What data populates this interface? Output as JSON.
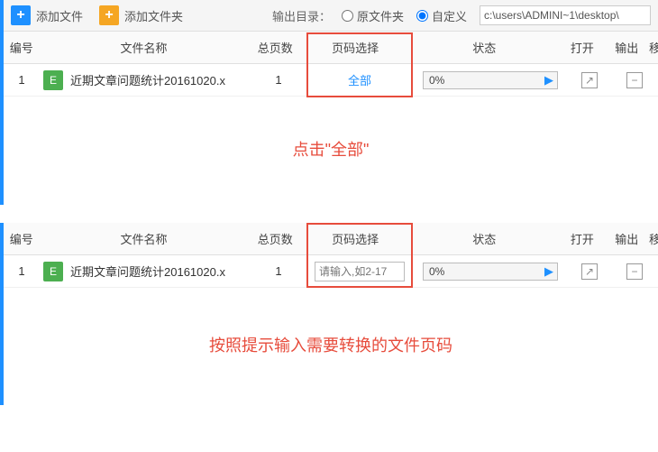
{
  "toolbar": {
    "add_file": "添加文件",
    "add_folder": "添加文件夹",
    "output_dir_label": "输出目录：",
    "original_folder": "原文件夹",
    "custom": "自定义",
    "path": "c:\\users\\ADMINI~1\\desktop\\"
  },
  "headers": {
    "num": "编号",
    "filename": "文件名称",
    "total_pages": "总页数",
    "page_select": "页码选择",
    "status": "状态",
    "open": "打开",
    "output": "输出",
    "extra": "移"
  },
  "row1": {
    "num": "1",
    "badge": "E",
    "name": "近期文章问题统计20161020.x",
    "pages": "1",
    "page_select": "全部",
    "progress": "0%"
  },
  "row2": {
    "num": "1",
    "badge": "E",
    "name": "近期文章问题统计20161020.x",
    "pages": "1",
    "page_select_placeholder": "请输入,如2-17",
    "progress": "0%"
  },
  "captions": {
    "c1": "点击\"全部\"",
    "c2": "按照提示输入需要转换的文件页码"
  }
}
